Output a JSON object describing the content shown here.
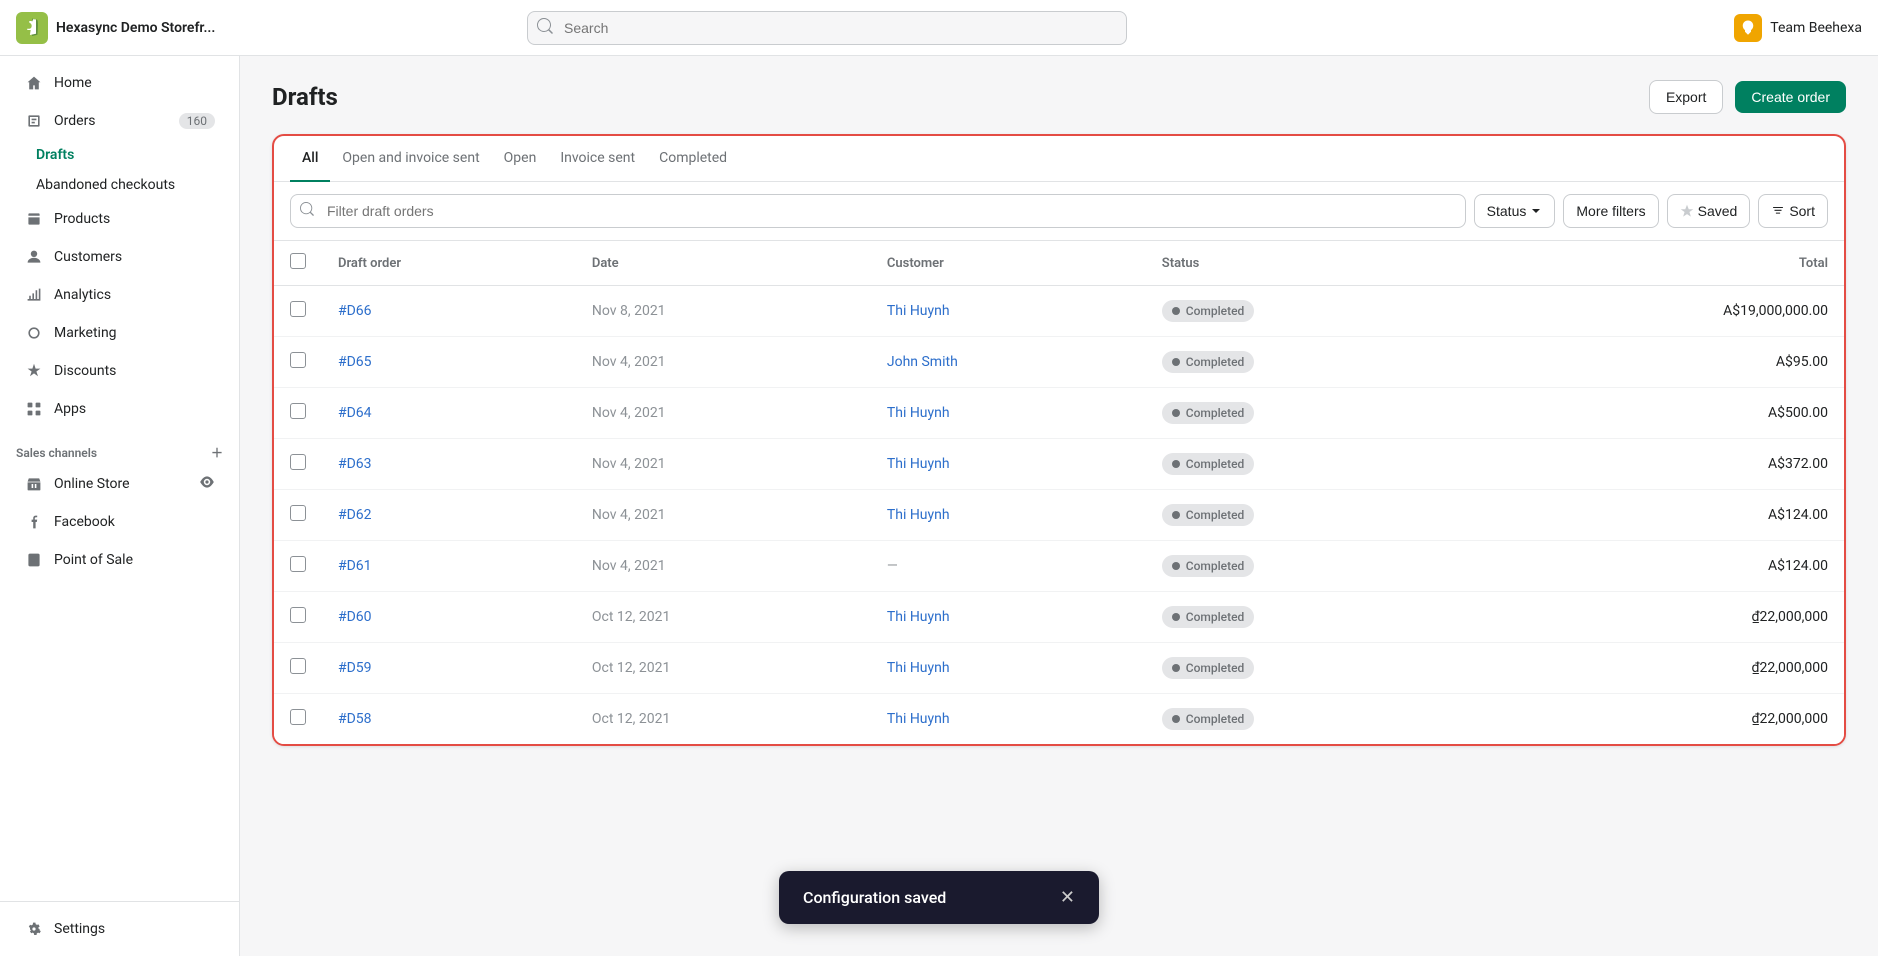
{
  "app": {
    "store_name": "Hexasync Demo Storefr...",
    "search_placeholder": "Search",
    "team_name": "Team Beehexa"
  },
  "sidebar": {
    "nav_items": [
      {
        "id": "home",
        "label": "Home",
        "icon": "home",
        "active": false
      },
      {
        "id": "orders",
        "label": "Orders",
        "icon": "orders",
        "badge": "160",
        "active": false
      },
      {
        "id": "drafts",
        "label": "Drafts",
        "icon": "",
        "active": true,
        "sub": true
      },
      {
        "id": "abandoned",
        "label": "Abandoned checkouts",
        "icon": "",
        "active": false,
        "sub": true
      },
      {
        "id": "products",
        "label": "Products",
        "icon": "products",
        "active": false
      },
      {
        "id": "customers",
        "label": "Customers",
        "icon": "customers",
        "active": false
      },
      {
        "id": "analytics",
        "label": "Analytics",
        "icon": "analytics",
        "active": false
      },
      {
        "id": "marketing",
        "label": "Marketing",
        "icon": "marketing",
        "active": false
      },
      {
        "id": "discounts",
        "label": "Discounts",
        "icon": "discounts",
        "active": false
      },
      {
        "id": "apps",
        "label": "Apps",
        "icon": "apps",
        "active": false
      }
    ],
    "sales_channels_label": "Sales channels",
    "sales_channels": [
      {
        "id": "online-store",
        "label": "Online Store",
        "icon": "store"
      },
      {
        "id": "facebook",
        "label": "Facebook",
        "icon": "facebook"
      },
      {
        "id": "point-of-sale",
        "label": "Point of Sale",
        "icon": "pos"
      }
    ],
    "settings_label": "Settings"
  },
  "page": {
    "title": "Drafts",
    "export_label": "Export",
    "create_label": "Create order"
  },
  "tabs": [
    {
      "id": "all",
      "label": "All",
      "active": true
    },
    {
      "id": "open-invoice",
      "label": "Open and invoice sent",
      "active": false
    },
    {
      "id": "open",
      "label": "Open",
      "active": false
    },
    {
      "id": "invoice-sent",
      "label": "Invoice sent",
      "active": false
    },
    {
      "id": "completed",
      "label": "Completed",
      "active": false
    }
  ],
  "toolbar": {
    "filter_placeholder": "Filter draft orders",
    "status_label": "Status",
    "more_filters_label": "More filters",
    "saved_label": "Saved",
    "sort_label": "Sort"
  },
  "table": {
    "columns": [
      {
        "id": "draft-order",
        "label": "Draft order"
      },
      {
        "id": "date",
        "label": "Date"
      },
      {
        "id": "customer",
        "label": "Customer"
      },
      {
        "id": "status",
        "label": "Status"
      },
      {
        "id": "total",
        "label": "Total",
        "align": "right"
      }
    ],
    "rows": [
      {
        "id": "#D66",
        "date": "Nov 8, 2021",
        "customer": "Thi Huynh",
        "customer_link": true,
        "status": "Completed",
        "total": "A$19,000,000.00"
      },
      {
        "id": "#D65",
        "date": "Nov 4, 2021",
        "customer": "John Smith",
        "customer_link": true,
        "status": "Completed",
        "total": "A$95.00"
      },
      {
        "id": "#D64",
        "date": "Nov 4, 2021",
        "customer": "Thi Huynh",
        "customer_link": true,
        "status": "Completed",
        "total": "A$500.00"
      },
      {
        "id": "#D63",
        "date": "Nov 4, 2021",
        "customer": "Thi Huynh",
        "customer_link": true,
        "status": "Completed",
        "total": "A$372.00"
      },
      {
        "id": "#D62",
        "date": "Nov 4, 2021",
        "customer": "Thi Huynh",
        "customer_link": true,
        "status": "Completed",
        "total": "A$124.00"
      },
      {
        "id": "#D61",
        "date": "Nov 4, 2021",
        "customer": "—",
        "customer_link": false,
        "status": "Completed",
        "total": "A$124.00"
      },
      {
        "id": "#D60",
        "date": "Oct 12, 2021",
        "customer": "Thi Huynh",
        "customer_link": true,
        "status": "Completed",
        "total": "₫22,000,000"
      },
      {
        "id": "#D59",
        "date": "Oct 12, 2021",
        "customer": "Thi Huynh",
        "customer_link": true,
        "status": "Completed",
        "total": "₫22,000,000"
      },
      {
        "id": "#D58",
        "date": "Oct 12, 2021",
        "customer": "Thi Huynh",
        "customer_link": true,
        "status": "Completed",
        "total": "₫22,000,000"
      }
    ]
  },
  "toast": {
    "message": "Configuration saved",
    "close_label": "✕"
  }
}
